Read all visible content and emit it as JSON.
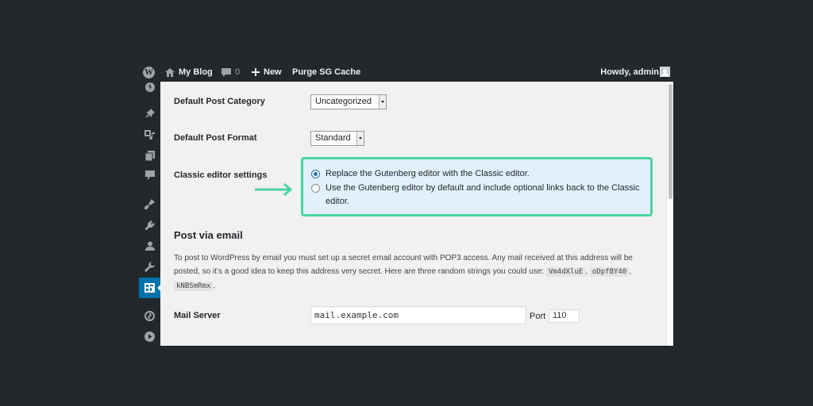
{
  "adminbar": {
    "site_name": "My Blog",
    "comments_count": "0",
    "new_label": "New",
    "purge_label": "Purge SG Cache",
    "howdy": "Howdy, admin"
  },
  "sidebar": {
    "icons": [
      "site-icon",
      "pin-icon",
      "media-icon",
      "pages-icon",
      "comments-icon",
      "appearance-icon",
      "plugins-icon",
      "users-icon",
      "tools-icon",
      "settings-icon",
      "sg-optimizer-icon",
      "play-icon"
    ],
    "active": "settings-icon"
  },
  "settings": {
    "default_category_label": "Default Post Category",
    "default_category_value": "Uncategorized",
    "default_format_label": "Default Post Format",
    "default_format_value": "Standard",
    "classic_label": "Classic editor settings",
    "classic_options": [
      {
        "label": "Replace the Gutenberg editor with the Classic editor.",
        "checked": true
      },
      {
        "label": "Use the Gutenberg editor by default and include optional links back to the Classic editor.",
        "checked": false
      }
    ]
  },
  "post_via_email": {
    "title": "Post via email",
    "desc_1": "To post to WordPress by email you must set up a secret email account with POP3 access. Any mail received at this address will be posted, so it’s a good idea to keep this address very secret. Here are three random strings you could use:",
    "codes": [
      "Vm4dXluE",
      "oDpfBY40",
      "kNBSmRmx"
    ],
    "mail_server_label": "Mail Server",
    "mail_server_value": "mail.example.com",
    "port_label": "Port",
    "port_value": "110"
  },
  "colors": {
    "highlight_border": "#4ad3a0",
    "highlight_bg": "#e2f0fb",
    "active_menu": "#0073aa"
  }
}
